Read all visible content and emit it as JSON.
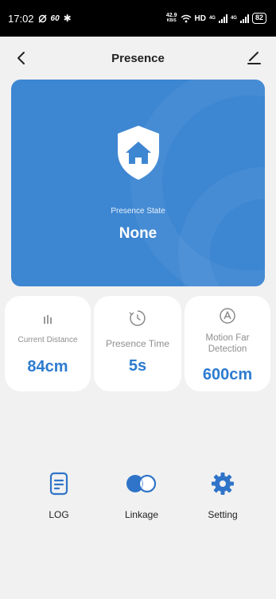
{
  "status_bar": {
    "time": "17:02",
    "indicators": "60",
    "speed_value": "42.9",
    "speed_unit": "KB/S",
    "hd": "HD",
    "net1": "4G",
    "net2": "4G",
    "battery": "82"
  },
  "header": {
    "title": "Presence"
  },
  "hero": {
    "label": "Presence State",
    "value": "None",
    "background": "#3d86d2"
  },
  "cards": [
    {
      "label": "Current Distance",
      "value": "84cm",
      "icon": "distance-icon"
    },
    {
      "label": "Presence Time",
      "value": "5s",
      "icon": "timer-icon"
    },
    {
      "label": "Motion Far Detection",
      "value": "600cm",
      "icon": "auto-icon"
    }
  ],
  "actions": [
    {
      "label": "LOG",
      "icon": "log-icon"
    },
    {
      "label": "Linkage",
      "icon": "toggle-icon"
    },
    {
      "label": "Setting",
      "icon": "gear-icon"
    }
  ],
  "colors": {
    "accent": "#2c7bd0",
    "icon_blue": "#2f74c8"
  }
}
